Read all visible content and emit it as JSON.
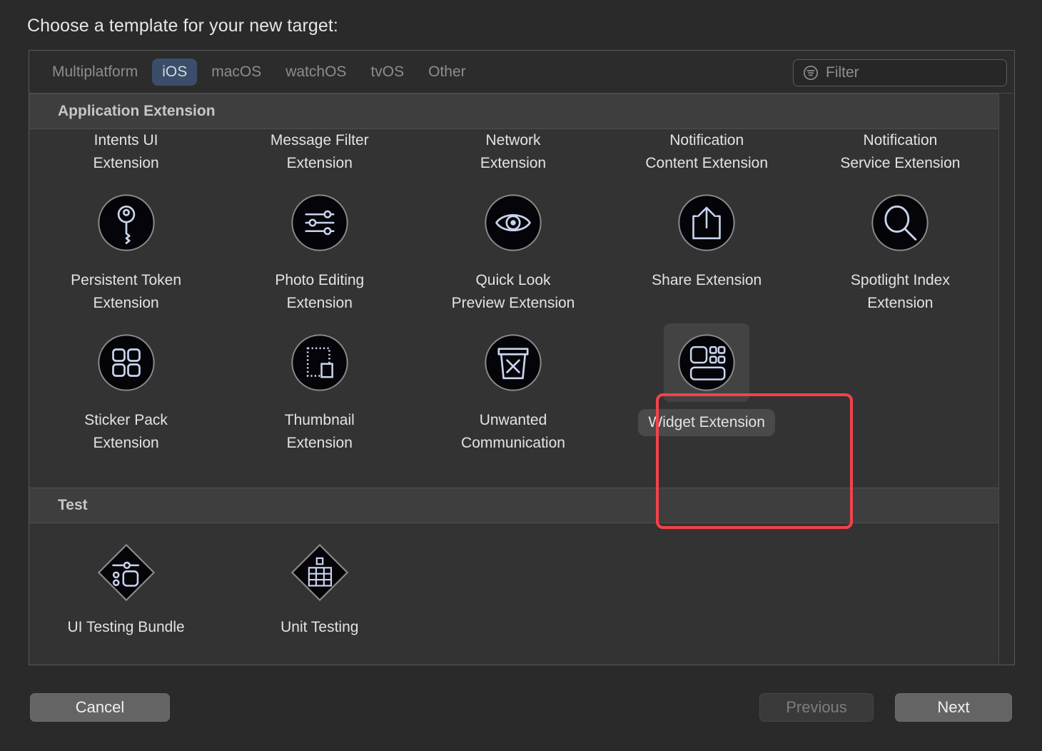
{
  "prompt": "Choose a template for your new target:",
  "toolbar": {
    "platforms": [
      {
        "label": "Multiplatform",
        "active": false
      },
      {
        "label": "iOS",
        "active": true
      },
      {
        "label": "macOS",
        "active": false
      },
      {
        "label": "watchOS",
        "active": false
      },
      {
        "label": "tvOS",
        "active": false
      },
      {
        "label": "Other",
        "active": false
      }
    ],
    "filter": {
      "placeholder": "Filter",
      "value": "",
      "icon": "filter-icon"
    }
  },
  "sections": [
    {
      "title": "Application Extension"
    },
    {
      "title": "Test"
    }
  ],
  "labels_row_partial": [
    "Intents UI\nExtension",
    "Message Filter\nExtension",
    "Network\nExtension",
    "Notification\nContent Extension",
    "Notification\nService Extension"
  ],
  "labels_row_2": [
    "Persistent Token\nExtension",
    "Photo Editing\nExtension",
    "Quick Look\nPreview Extension",
    "Share Extension",
    "Spotlight Index\nExtension"
  ],
  "labels_row_3": [
    "Sticker Pack\nExtension",
    "Thumbnail\nExtension",
    "Unwanted\nCommunication",
    "Widget Extension",
    ""
  ],
  "icons_row_1": [
    "key-icon",
    "sliders-icon",
    "eye-icon",
    "share-icon",
    "magnifier-icon"
  ],
  "icons_row_2": [
    "four-squares-icon",
    "thumbnail-icon",
    "trash-x-icon",
    "widget-icon",
    ""
  ],
  "test_icons": [
    "ui-test-diamond-icon",
    "unit-test-diamond-icon",
    "",
    "",
    ""
  ],
  "test_labels": [
    "UI Testing Bundle",
    "Unit Testing",
    "",
    "",
    ""
  ],
  "selection": {
    "template": "Widget Extension",
    "highlight_color": "#f4424a"
  },
  "buttons": {
    "cancel": "Cancel",
    "previous": "Previous",
    "next": "Next",
    "previous_enabled": false
  },
  "colors": {
    "window_bg": "#2a2a2a",
    "panel_bg": "#333333",
    "section_header_bg": "#3e3e3e",
    "active_tab_bg": "#3b4e69",
    "icon_stroke": "#c9d4ef",
    "selection_red": "#f4424a"
  }
}
